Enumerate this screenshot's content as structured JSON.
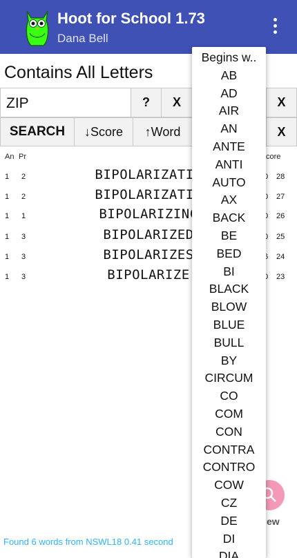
{
  "app": {
    "title": "Hoot for School 1.73",
    "user": "Dana Bell",
    "brand_color": "#3F51B5",
    "owl_color": "#39FF14"
  },
  "search": {
    "mode_title": "Contains All Letters",
    "input_value": "ZIP",
    "help_label": "?",
    "clear_label": "X",
    "second_clear_label": "X",
    "third_clear_label": "X",
    "search_label": "SEARCH",
    "sort_score_label": "↓Score",
    "sort_word_label": "↑Word"
  },
  "results": {
    "columns": {
      "an": "An",
      "pr": "Pr",
      "score": "core"
    },
    "rows": [
      {
        "an": "1",
        "pr": "2",
        "word": "BIPOLARIZATIO",
        "c1": "0",
        "c2": "28"
      },
      {
        "an": "1",
        "pr": "2",
        "word": "BIPOLARIZATIC",
        "c1": "0",
        "c2": "27"
      },
      {
        "an": "1",
        "pr": "1",
        "word": "BIPOLARIZINC",
        "c1": "0",
        "c2": "26"
      },
      {
        "an": "1",
        "pr": "3",
        "word": "BIPOLARIZED",
        "c1": "0",
        "c2": "25"
      },
      {
        "an": "1",
        "pr": "3",
        "word": "BIPOLARIZES",
        "c1": "6",
        "c2": "24"
      },
      {
        "an": "1",
        "pr": "3",
        "word": "BIPOLARIZE",
        "c1": "0",
        "c2": "23"
      }
    ]
  },
  "fab": {
    "label": "ew",
    "icon": "search-icon"
  },
  "status": "Found 6 words from NSWL18   0.41 second",
  "dropdown": {
    "items": [
      "Begins w..",
      "AB",
      "AD",
      "AIR",
      "AN",
      "ANTE",
      "ANTI",
      "AUTO",
      "AX",
      "BACK",
      "BE",
      "BED",
      "BI",
      "BLACK",
      "BLOW",
      "BLUE",
      "BULL",
      "BY",
      "CIRCUM",
      "CO",
      "COM",
      "CON",
      "CONTRA",
      "CONTRO",
      "COW",
      "CZ",
      "DE",
      "DI",
      "DIA"
    ]
  }
}
